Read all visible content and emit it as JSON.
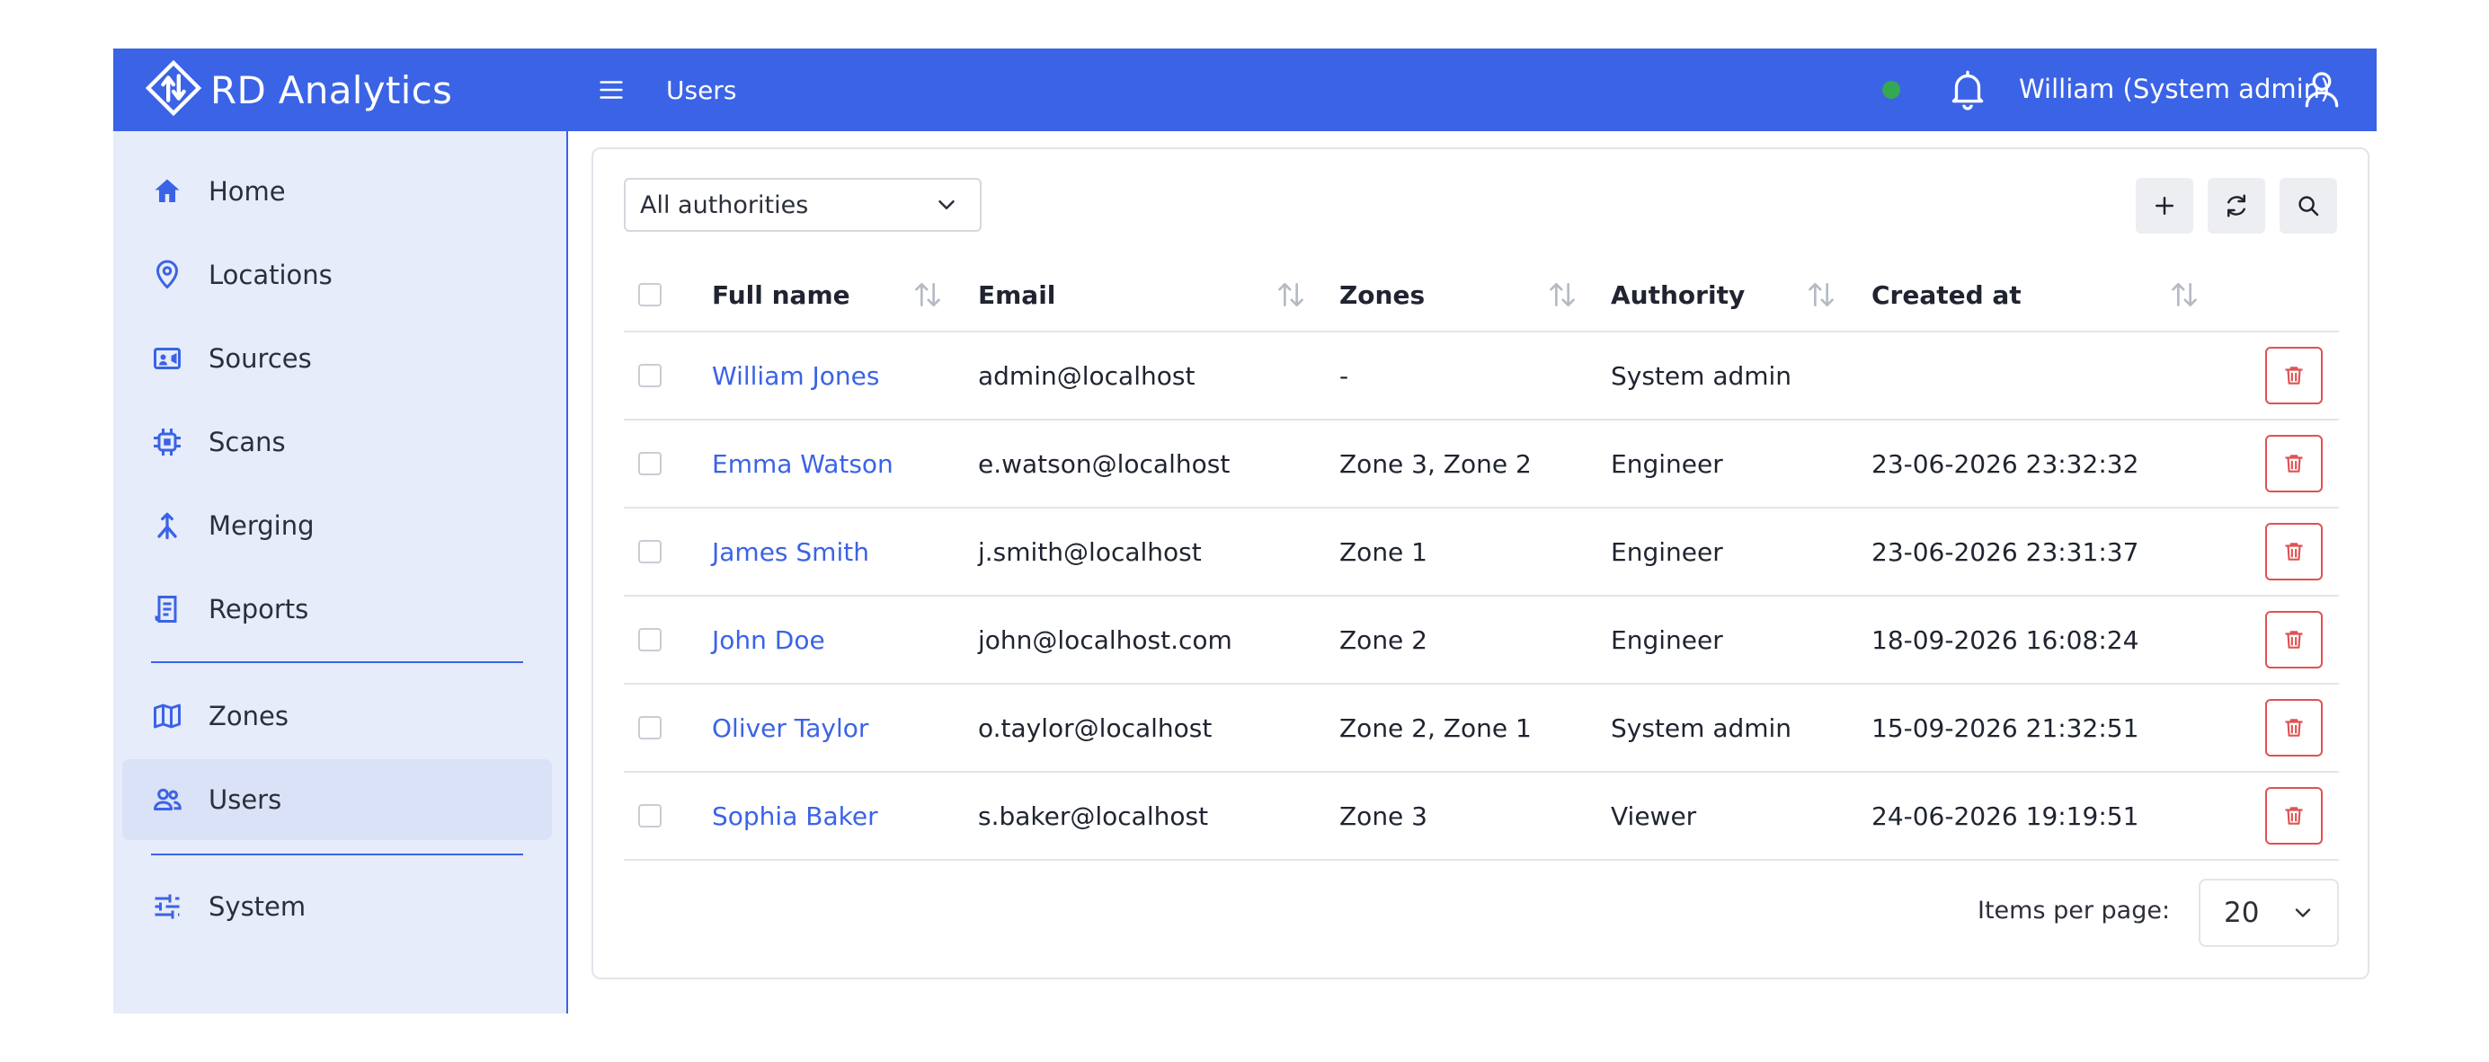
{
  "app": {
    "brand_name": "RD Analytics",
    "page_title": "Users"
  },
  "header": {
    "user_label": "William (System admin)",
    "status_color": "#35a853",
    "accent": "#3b63e6"
  },
  "sidebar": {
    "items": [
      {
        "label": "Home",
        "icon": "home-icon"
      },
      {
        "label": "Locations",
        "icon": "location-pin-icon"
      },
      {
        "label": "Sources",
        "icon": "video-camera-icon"
      },
      {
        "label": "Scans",
        "icon": "chip-icon"
      },
      {
        "label": "Merging",
        "icon": "merge-icon"
      },
      {
        "label": "Reports",
        "icon": "report-icon"
      },
      {
        "label": "Zones",
        "icon": "map-icon"
      },
      {
        "label": "Users",
        "icon": "users-icon",
        "active": true
      },
      {
        "label": "System",
        "icon": "sliders-icon"
      }
    ]
  },
  "toolbar": {
    "filter_value": "All authorities"
  },
  "table": {
    "columns": [
      "Full name",
      "Email",
      "Zones",
      "Authority",
      "Created at"
    ],
    "rows": [
      {
        "name": "William Jones",
        "email": "admin@localhost",
        "zones": "-",
        "authority": "System admin",
        "created": ""
      },
      {
        "name": "Emma Watson",
        "email": "e.watson@localhost",
        "zones": "Zone 3, Zone 2",
        "authority": "Engineer",
        "created": "23-06-2026 23:32:32"
      },
      {
        "name": "James Smith",
        "email": "j.smith@localhost",
        "zones": "Zone 1",
        "authority": "Engineer",
        "created": "23-06-2026 23:31:37"
      },
      {
        "name": "John Doe",
        "email": "john@localhost.com",
        "zones": "Zone 2",
        "authority": "Engineer",
        "created": "18-09-2026 16:08:24"
      },
      {
        "name": "Oliver Taylor",
        "email": "o.taylor@localhost",
        "zones": "Zone 2, Zone 1",
        "authority": "System admin",
        "created": "15-09-2026 21:32:51"
      },
      {
        "name": "Sophia Baker",
        "email": "s.baker@localhost",
        "zones": "Zone 3",
        "authority": "Viewer",
        "created": "24-06-2026 19:19:51"
      }
    ]
  },
  "pagination": {
    "label": "Items per page:",
    "value": "20"
  }
}
